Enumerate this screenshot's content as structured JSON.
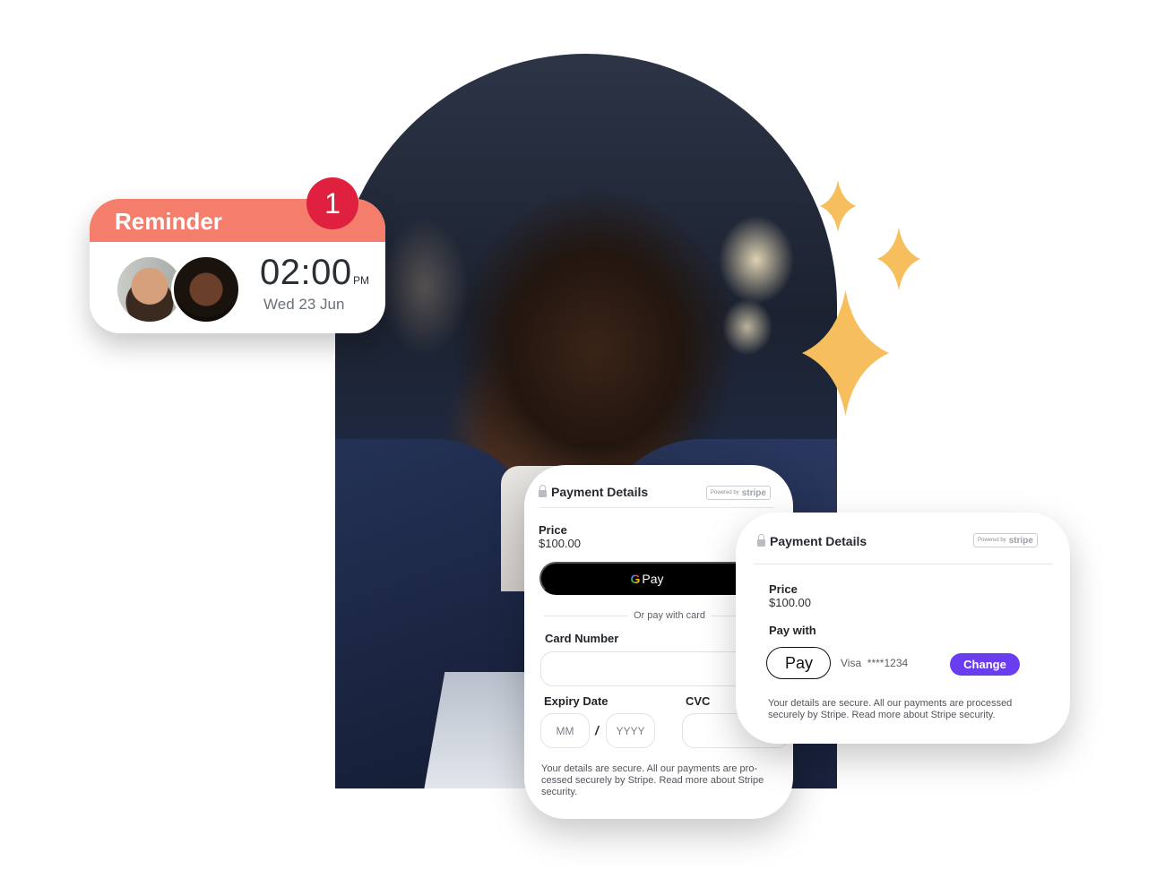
{
  "reminder": {
    "title": "Reminder",
    "badge_count": "1",
    "time": "02:00",
    "ampm": "PM",
    "date": "Wed 23 Jun",
    "colors": {
      "header": "#f47e6b",
      "badge": "#e0203f"
    }
  },
  "payment_card_full": {
    "title": "Payment Details",
    "powered_by": "Powered by",
    "brand": "stripe",
    "price_label": "Price",
    "price_value": "$100.00",
    "gpay_g": "G",
    "gpay_label": "Pay",
    "or_text": "Or pay with card",
    "card_number_label": "Card Number",
    "card_number_value": "",
    "expiry_label": "Expiry Date",
    "expiry_month_placeholder": "MM",
    "expiry_separator": "/",
    "expiry_year_placeholder": "YYYY",
    "cvc_label": "CVC",
    "cvc_value": "",
    "secure_text": "Your details are secure. All our payments are pro-cessed securely by Stripe. Read more about Stripe security."
  },
  "payment_card_saved": {
    "title": "Payment Details",
    "powered_by": "Powered by",
    "brand": "stripe",
    "price_label": "Price",
    "price_value": "$100.00",
    "pay_with_label": "Pay with",
    "applepay_icon": "",
    "applepay_label": "Pay",
    "card_summary": "Visa  ****1234",
    "change_label": "Change",
    "secure_text": "Your details are secure. All our payments are processed securely by Stripe. Read more about Stripe security.",
    "colors": {
      "accent": "#6a3df0"
    }
  },
  "decor": {
    "sparkle_color": "#f6be5c"
  }
}
